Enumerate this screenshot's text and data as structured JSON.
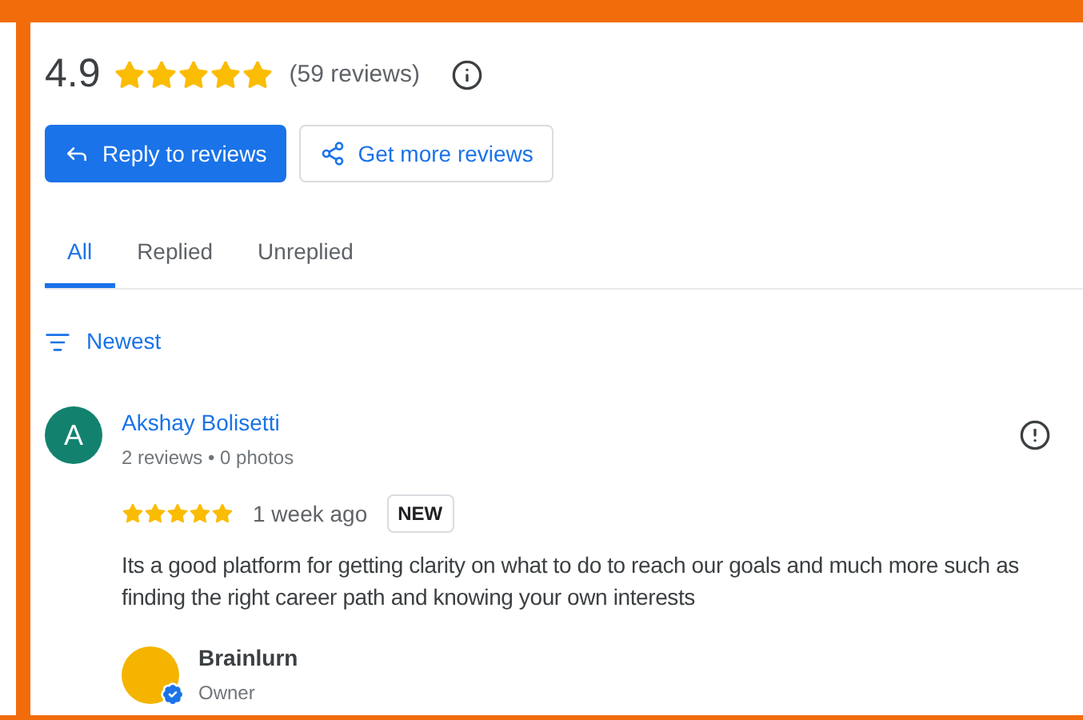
{
  "summary": {
    "rating": "4.9",
    "stars": 5,
    "count": "(59 reviews)"
  },
  "buttons": [
    {
      "kind": "primary",
      "label": "Reply to reviews"
    },
    {
      "kind": "outline",
      "label": "Get more reviews"
    }
  ],
  "tabs": [
    {
      "label": "All",
      "selected": true
    },
    {
      "label": "Replied",
      "selected": false
    },
    {
      "label": "Unreplied",
      "selected": false
    }
  ],
  "sort": {
    "label": "Newest"
  },
  "review": {
    "avatar_letter": "A",
    "name": "Akshay Bolisetti",
    "meta": "2 reviews • 0 photos",
    "stars": 5,
    "time": "1 week ago",
    "badge": "NEW",
    "text": "Its a good platform for getting clarity on what to do to reach our goals and much more such as finding the right career path and knowing your own interests",
    "reply": {
      "name": "Brainlurn",
      "role": "Owner",
      "verified": true
    }
  }
}
